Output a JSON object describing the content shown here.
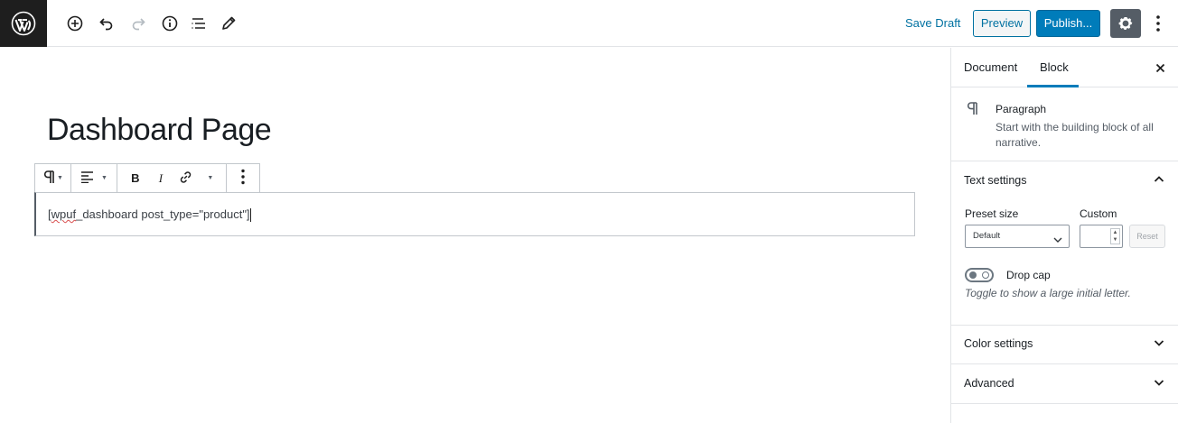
{
  "topbar": {
    "logo": "wordpress-logo",
    "icons": [
      "add-block-icon",
      "undo-icon",
      "redo-icon",
      "info-icon",
      "outline-icon",
      "edit-tools-icon"
    ],
    "save_draft": "Save Draft",
    "preview": "Preview",
    "publish": "Publish...",
    "settings_icon": "gear-icon",
    "more_icon": "more-vertical-icon",
    "accent_color": "#007cba"
  },
  "editor": {
    "title": "Dashboard Page",
    "paragraph": {
      "prefix": "[",
      "misspelled": "wpuf",
      "rest": "_dashboard post_type=\"product\"]"
    },
    "toolbar": {
      "icons": [
        "paragraph-icon",
        "align-left-icon",
        "bold-icon",
        "italic-icon",
        "link-icon",
        "more-rich-text-icon",
        "more-options-icon"
      ]
    }
  },
  "sidebar": {
    "tabs": [
      {
        "label": "Document",
        "active": false
      },
      {
        "label": "Block",
        "active": true
      }
    ],
    "block_card": {
      "icon": "paragraph-icon",
      "title": "Paragraph",
      "description": "Start with the building block of all narrative."
    },
    "text_settings": {
      "title": "Text settings",
      "preset_label": "Preset size",
      "preset_value": "Default",
      "custom_label": "Custom",
      "custom_value": "",
      "reset": "Reset",
      "drop_cap_label": "Drop cap",
      "drop_cap_help": "Toggle to show a large initial letter."
    },
    "color_settings": {
      "title": "Color settings"
    },
    "advanced": {
      "title": "Advanced"
    }
  }
}
